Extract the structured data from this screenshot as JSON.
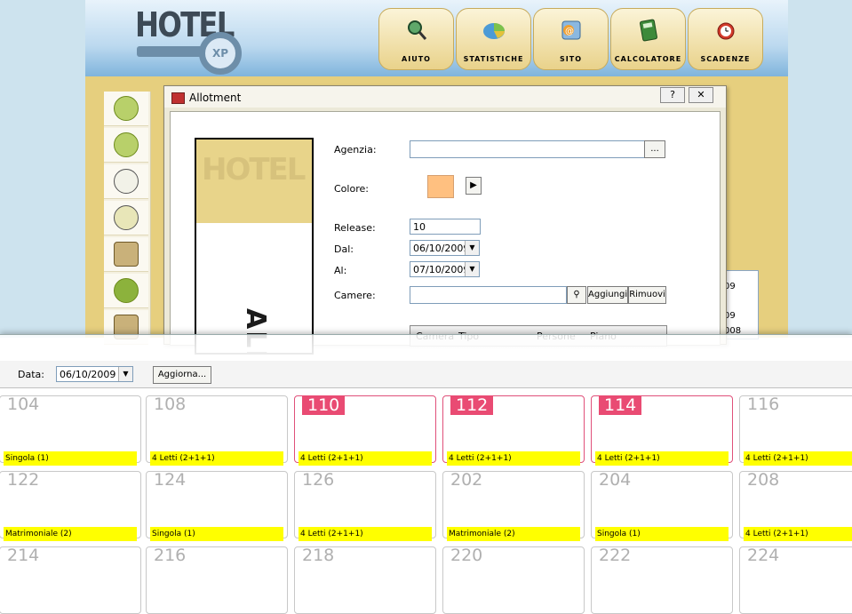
{
  "app": {
    "logo_text": "HOTEL",
    "logo_badge": "XP"
  },
  "topnav": [
    {
      "label": "AIUTO",
      "icon": "magnifier-icon"
    },
    {
      "label": "STATISTICHE",
      "icon": "pie-chart-icon"
    },
    {
      "label": "SITO",
      "icon": "globe-icon"
    },
    {
      "label": "CALCOLATORE",
      "icon": "calculator-icon"
    },
    {
      "label": "SCADENZE",
      "icon": "alarm-clock-icon"
    }
  ],
  "sidebar": [
    {
      "icon": "people-icon"
    },
    {
      "icon": "drink-icon"
    },
    {
      "icon": "piggy-bank-icon"
    },
    {
      "icon": "cheese-icon"
    },
    {
      "icon": "mug-icon"
    },
    {
      "icon": "tomato-icon"
    },
    {
      "icon": "house-icon"
    }
  ],
  "right_panel": [
    "09",
    "09",
    "008"
  ],
  "dialog": {
    "title": "Allotment",
    "help_label": "?",
    "close_label": "✕",
    "banner_hotel": "HOTEL",
    "banner_vertical": "ALLOTMENT",
    "fields": {
      "agenzia_label": "Agenzia:",
      "agenzia_value": "",
      "agenzia_button": "...",
      "colore_label": "Colore:",
      "colore_value": "#ffc080",
      "release_label": "Release:",
      "release_value": "10",
      "dal_label": "Dal:",
      "dal_value": "06/10/2009",
      "al_label": "Al:",
      "al_value": "07/10/2009",
      "camere_label": "Camere:",
      "camere_value": "",
      "aggiungi_label": "Aggiungi",
      "rimuovi_label": "Rimuovi"
    },
    "table_headers": [
      "Camera",
      "Tipo",
      "Persone",
      "Piano"
    ]
  },
  "toolbar": {
    "data_label": "Data:",
    "data_value": "06/10/2009",
    "aggiorna_label": "Aggiorna..."
  },
  "rooms": [
    {
      "number": "104",
      "type": "Singola (1)",
      "highlighted": false
    },
    {
      "number": "108",
      "type": "4 Letti (2+1+1)",
      "highlighted": false
    },
    {
      "number": "110",
      "type": "4 Letti (2+1+1)",
      "highlighted": true
    },
    {
      "number": "112",
      "type": "4 Letti (2+1+1)",
      "highlighted": true
    },
    {
      "number": "114",
      "type": "4 Letti (2+1+1)",
      "highlighted": true
    },
    {
      "number": "116",
      "type": "4 Letti (2+1+1)",
      "highlighted": false
    },
    {
      "number": "122",
      "type": "Matrimoniale (2)",
      "highlighted": false
    },
    {
      "number": "124",
      "type": "Singola (1)",
      "highlighted": false
    },
    {
      "number": "126",
      "type": "4 Letti (2+1+1)",
      "highlighted": false
    },
    {
      "number": "202",
      "type": "Matrimoniale (2)",
      "highlighted": false
    },
    {
      "number": "204",
      "type": "Singola (1)",
      "highlighted": false
    },
    {
      "number": "208",
      "type": "4 Letti (2+1+1)",
      "highlighted": false
    },
    {
      "number": "214",
      "type": "",
      "highlighted": false
    },
    {
      "number": "216",
      "type": "",
      "highlighted": false
    },
    {
      "number": "218",
      "type": "",
      "highlighted": false
    },
    {
      "number": "220",
      "type": "",
      "highlighted": false
    },
    {
      "number": "222",
      "type": "",
      "highlighted": false
    },
    {
      "number": "224",
      "type": "",
      "highlighted": false
    }
  ]
}
